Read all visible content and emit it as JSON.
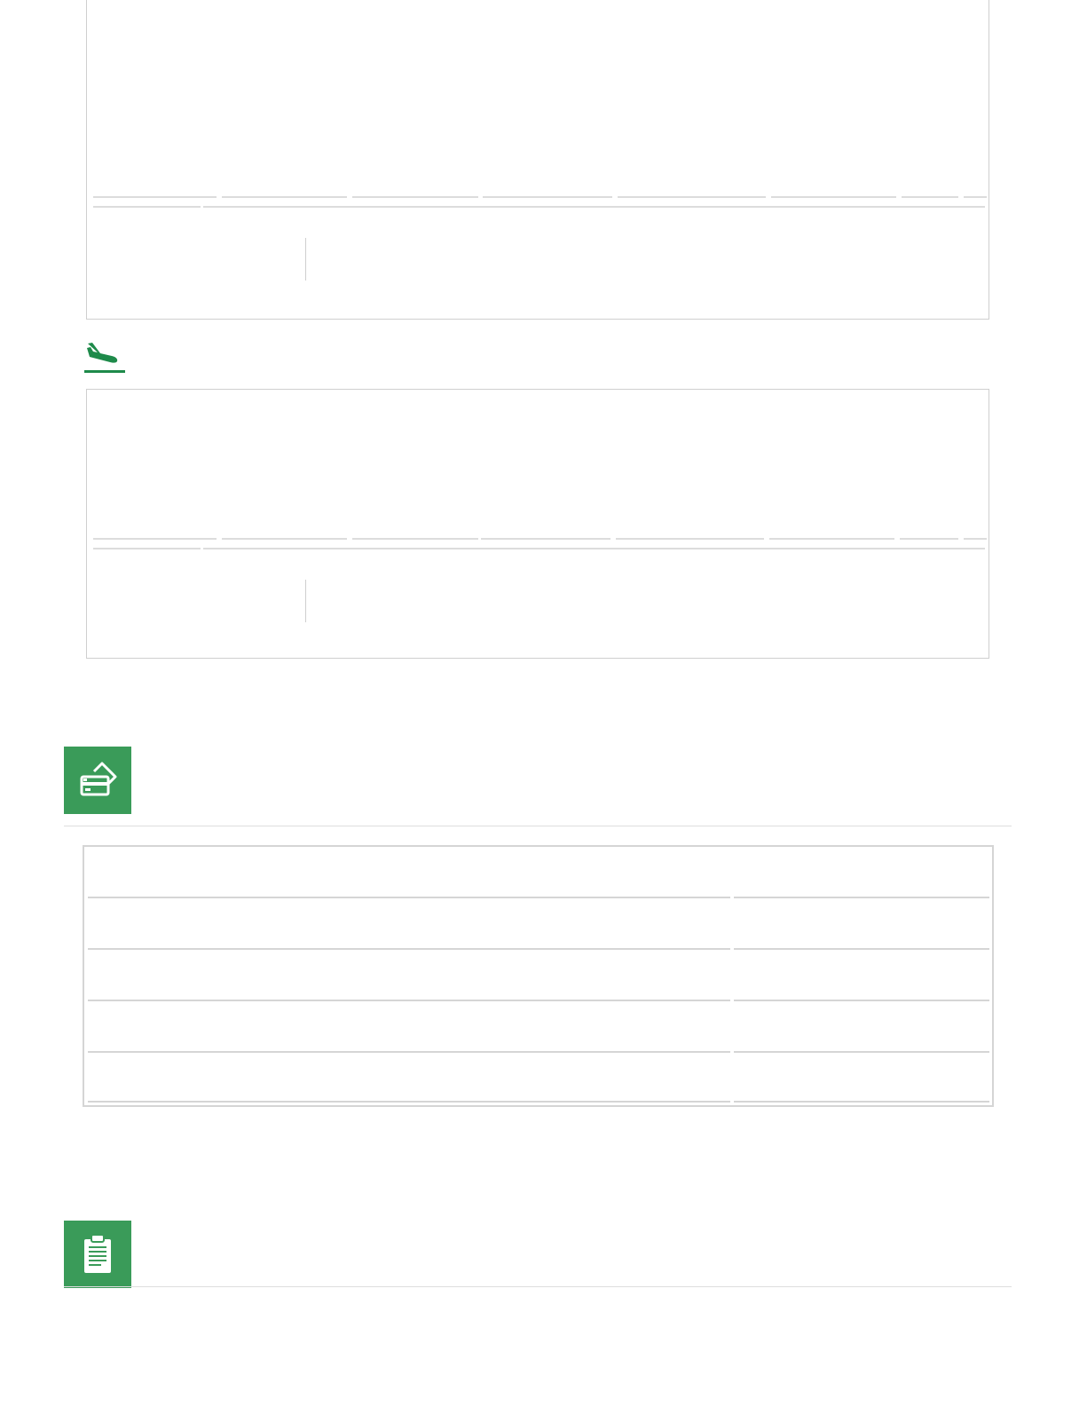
{
  "sections": {
    "flight_outbound": {
      "label": ""
    },
    "flight_return": {
      "label": ""
    },
    "payment": {
      "title": "",
      "icon": "credit-cards-icon"
    },
    "notes": {
      "title": "",
      "icon": "clipboard-icon"
    }
  },
  "colors": {
    "accent": "#3a9b59",
    "border": "#cfcfcf",
    "divider": "#dcdcdc"
  },
  "payment_table": {
    "rows": [
      {
        "label": "",
        "value": ""
      },
      {
        "label": "",
        "value": ""
      },
      {
        "label": "",
        "value": ""
      },
      {
        "label": "",
        "value": ""
      }
    ]
  }
}
